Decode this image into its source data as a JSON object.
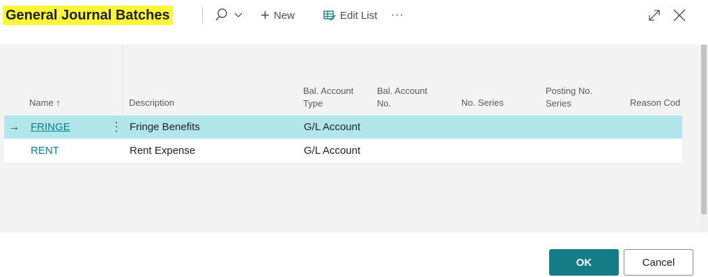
{
  "header": {
    "title": "General Journal Batches",
    "new_label": "New",
    "edit_list_label": "Edit List",
    "more_label": "···"
  },
  "columns": {
    "name": "Name",
    "name_sort_arrow": "↑",
    "description": "Description",
    "bal_account_type_1": "Bal. Account",
    "bal_account_type_2": "Type",
    "bal_account_no_1": "Bal. Account",
    "bal_account_no_2": "No.",
    "no_series": "No. Series",
    "posting_no_series_1": "Posting No.",
    "posting_no_series_2": "Series",
    "reason_code": "Reason Cod"
  },
  "rows": [
    {
      "name": "FRINGE",
      "description": "Fringe Benefits",
      "bal_account_type": "G/L Account",
      "selected": true
    },
    {
      "name": "RENT",
      "description": "Rent Expense",
      "bal_account_type": "G/L Account",
      "selected": false
    }
  ],
  "footer": {
    "ok_label": "OK",
    "cancel_label": "Cancel"
  },
  "colors": {
    "title_highlight": "#fbf63a",
    "selected_row": "#b1e6eb",
    "link": "#0a7f8c",
    "primary_button": "#137c86"
  }
}
